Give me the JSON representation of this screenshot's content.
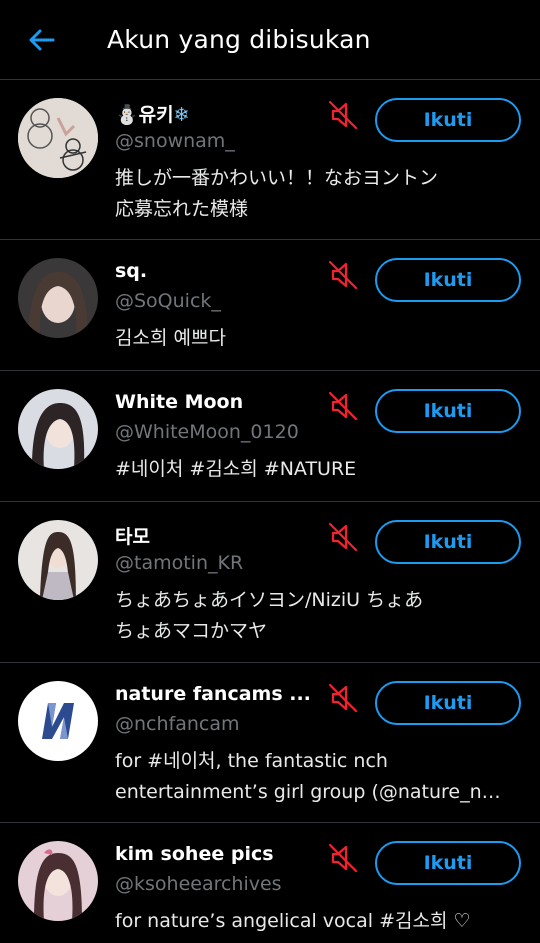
{
  "header": {
    "title": "Akun yang dibisukan",
    "back_icon": "arrow-left-icon",
    "accent": "#1d9bf0"
  },
  "colors": {
    "mute": "#f4212e",
    "handle": "#71767b",
    "divider": "#2f3336"
  },
  "users": [
    {
      "name": "유키",
      "name_prefix_icon": "snowman-emoji",
      "name_suffix_icon": "snowflake-emoji",
      "handle": "@snownam_",
      "bio": [
        "推しが一番かわいい！！なおヨントン",
        "応募忘れた模様"
      ],
      "follow_label": "Ikuti"
    },
    {
      "name": "sq.",
      "handle": "@SoQuick_",
      "bio": [
        "김소희 예쁘다"
      ],
      "follow_label": "Ikuti"
    },
    {
      "name": "White Moon",
      "handle": "@WhiteMoon_0120",
      "bio": [
        "#네이처 #김소희 #NATURE"
      ],
      "follow_label": "Ikuti"
    },
    {
      "name": "타모",
      "handle": "@tamotin_KR",
      "bio": [
        "ちょあちょあイソヨン/NiziU ちょあ",
        "ちょあマコかマヤ"
      ],
      "follow_label": "Ikuti"
    },
    {
      "name": "nature fancams ...",
      "handle": "@nchfancam",
      "bio": [
        "for #네이처, the fantastic nch",
        "entertainment’s girl group (@nature_n…"
      ],
      "follow_label": "Ikuti"
    },
    {
      "name": "kim sohee pics",
      "handle": "@ksoheearchives",
      "bio": [
        "for nature’s angelical vocal #김소희 ♡"
      ],
      "follow_label": "Ikuti"
    }
  ]
}
